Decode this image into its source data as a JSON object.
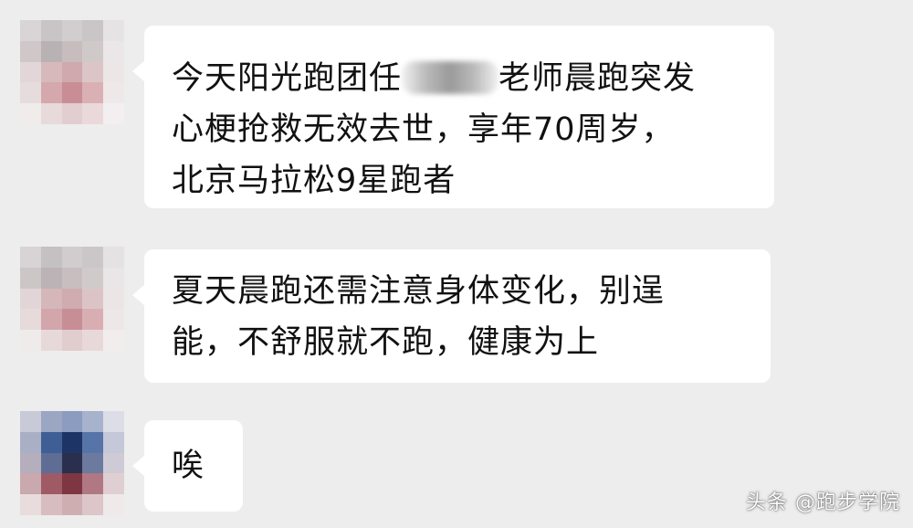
{
  "messages": [
    {
      "lines": [
        "今天阳光跑团任",
        "老师晨跑突发",
        "心梗抢救无效去世，享年70周岁，",
        "北京马拉松9星跑者"
      ]
    },
    {
      "lines": [
        "夏天晨跑还需注意身体变化，别逞",
        "能，不舒服就不跑，健康为上"
      ]
    },
    {
      "lines": [
        "唉"
      ]
    }
  ],
  "watermark": "头条 @跑步学院",
  "colors": {
    "background": "#ededed",
    "bubble": "#ffffff",
    "text": "#111111"
  }
}
